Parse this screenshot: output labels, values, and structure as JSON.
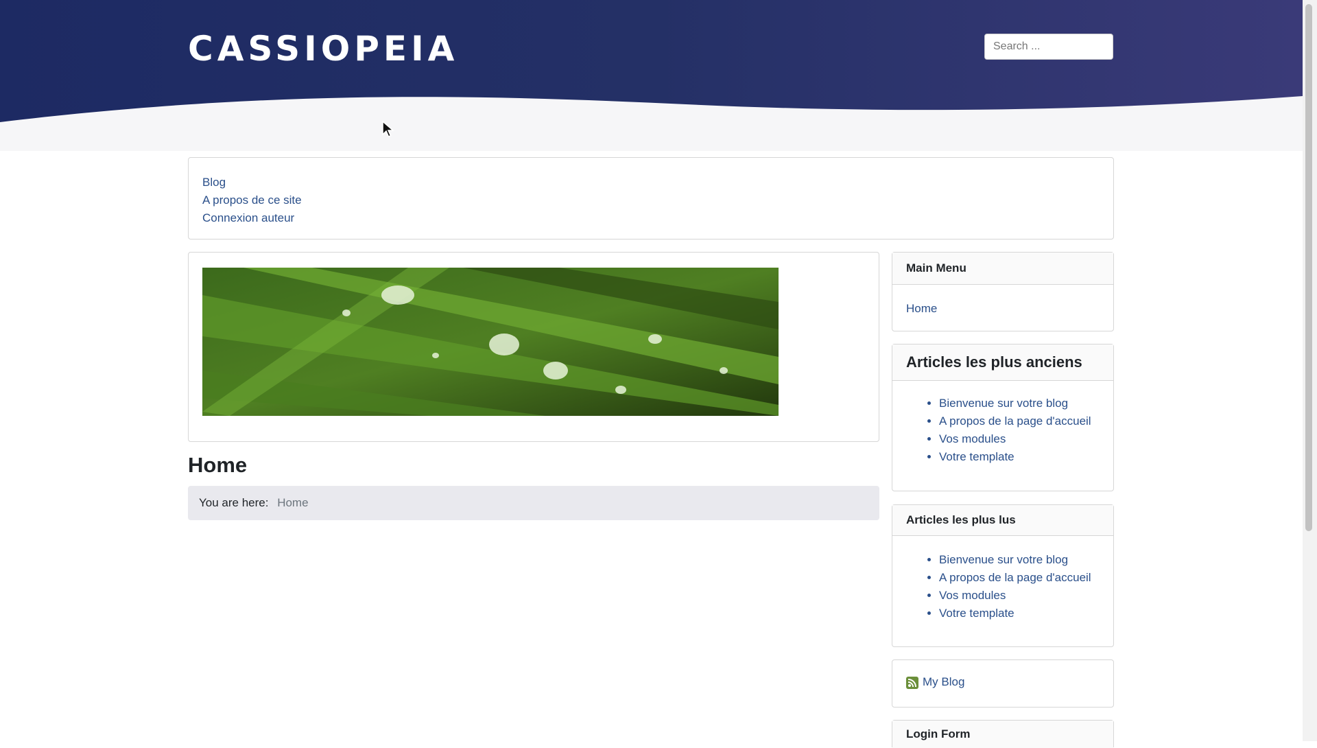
{
  "header": {
    "brand": "CASSIOPEIA",
    "search_placeholder": "Search ..."
  },
  "nav_menu": {
    "items": [
      "Blog",
      "A propos de ce site",
      "Connexion auteur"
    ]
  },
  "banner": {
    "alt": "Grass blades with water droplets"
  },
  "main": {
    "page_title": "Home",
    "breadcrumb_label": "You are here:",
    "breadcrumb_current": "Home"
  },
  "sidebar": {
    "main_menu": {
      "title": "Main Menu",
      "items": [
        "Home"
      ]
    },
    "oldest": {
      "title": "Articles les plus anciens",
      "items": [
        "Bienvenue sur votre blog",
        "A propos de la page d'accueil",
        "Vos modules",
        "Votre template"
      ]
    },
    "popular": {
      "title": "Articles les plus lus",
      "items": [
        "Bienvenue sur votre blog",
        "A propos de la page d'accueil",
        "Vos modules",
        "Votre template"
      ]
    },
    "feed": {
      "label": "My Blog",
      "icon": "rss-feed-icon"
    },
    "login": {
      "title": "Login Form"
    }
  },
  "colors": {
    "header_start": "#1d2a63",
    "header_end": "#3a3a78",
    "link": "#2a4f8a"
  }
}
